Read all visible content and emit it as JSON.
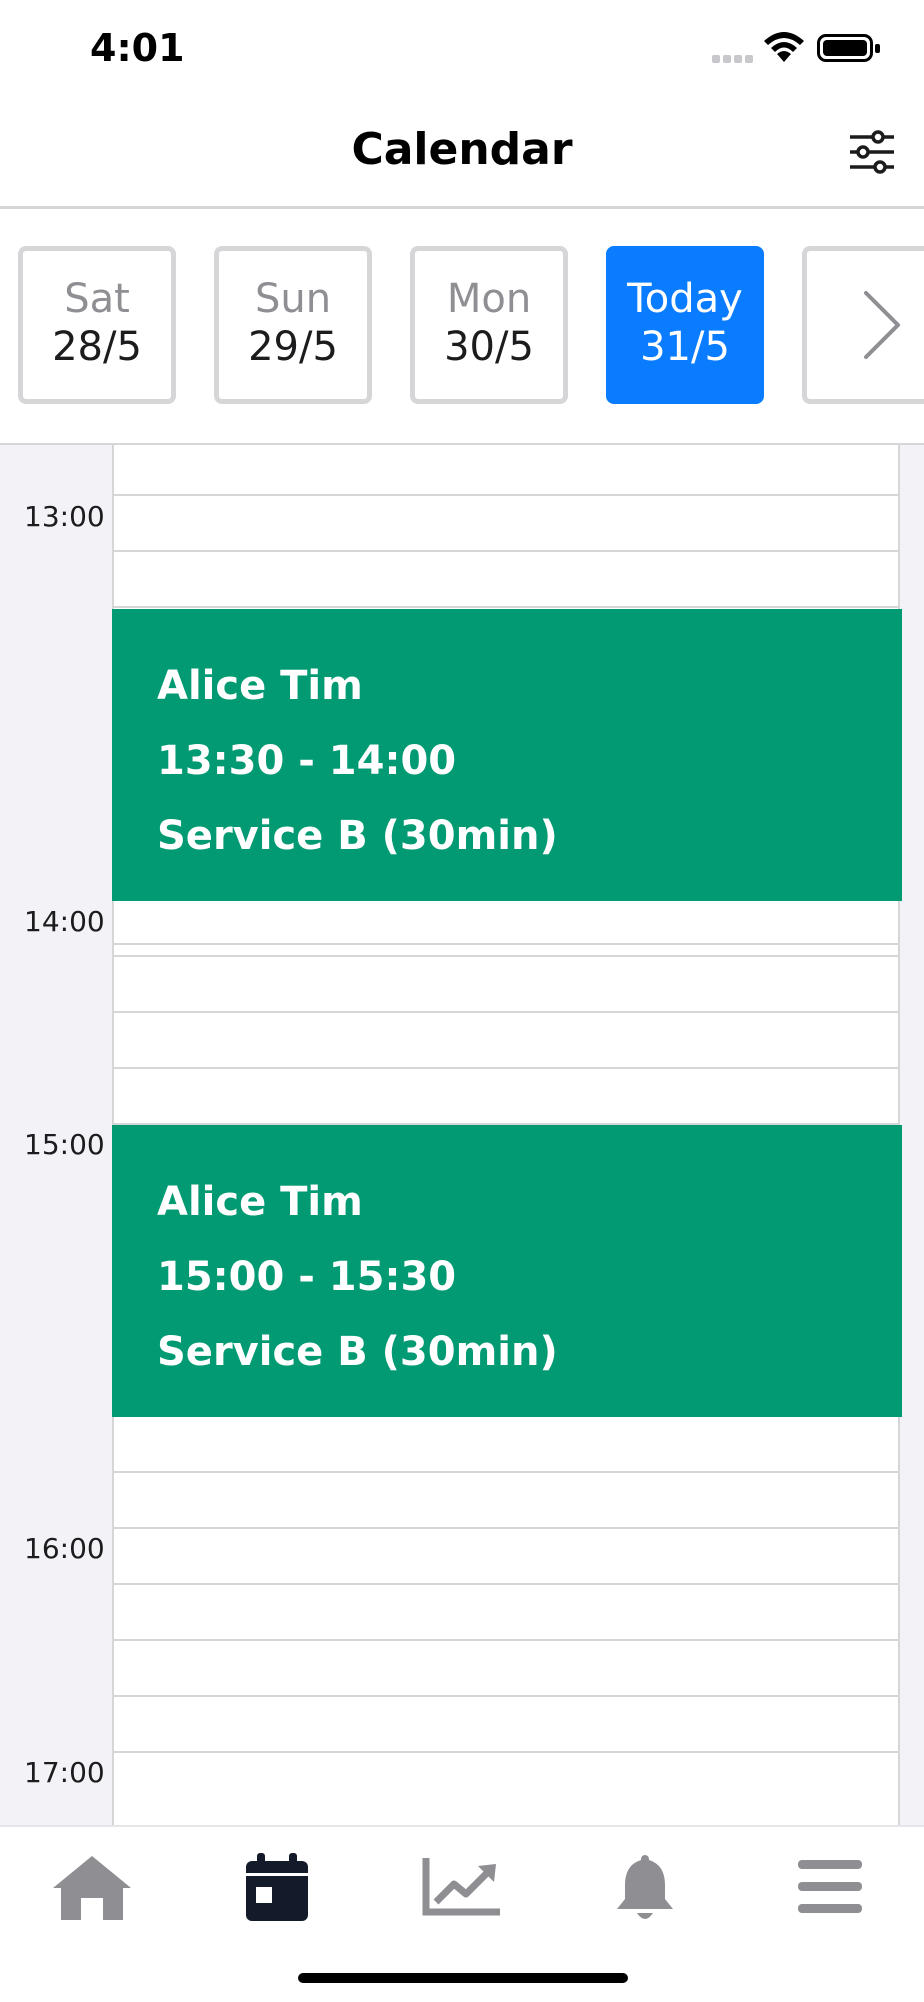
{
  "status_bar": {
    "time": "4:01"
  },
  "header": {
    "title": "Calendar",
    "filter_icon": "sliders-icon"
  },
  "dates": [
    {
      "name": "Sat",
      "date": "28/5",
      "selected": false
    },
    {
      "name": "Sun",
      "date": "29/5",
      "selected": false
    },
    {
      "name": "Mon",
      "date": "30/5",
      "selected": false
    },
    {
      "name": "Today",
      "date": "31/5",
      "selected": true
    }
  ],
  "next_icon": "chevron-right-icon",
  "hours": [
    "13:00",
    "14:00",
    "15:00",
    "16:00",
    "17:00"
  ],
  "events": [
    {
      "name": "Alice Tim",
      "time": "13:30 - 14:00",
      "service": "Service B (30min)"
    },
    {
      "name": "Alice Tim",
      "time": "15:00 - 15:30",
      "service": "Service B (30min)"
    }
  ],
  "colors": {
    "accent": "#0a7cff",
    "event": "#019a72",
    "active_tab": "#131a2a",
    "inactive_tab": "#8e8e93"
  },
  "tab_bar": [
    {
      "icon": "home-icon",
      "active": false
    },
    {
      "icon": "calendar-icon",
      "active": true
    },
    {
      "icon": "chart-icon",
      "active": false
    },
    {
      "icon": "bell-icon",
      "active": false
    },
    {
      "icon": "menu-icon",
      "active": false
    }
  ]
}
